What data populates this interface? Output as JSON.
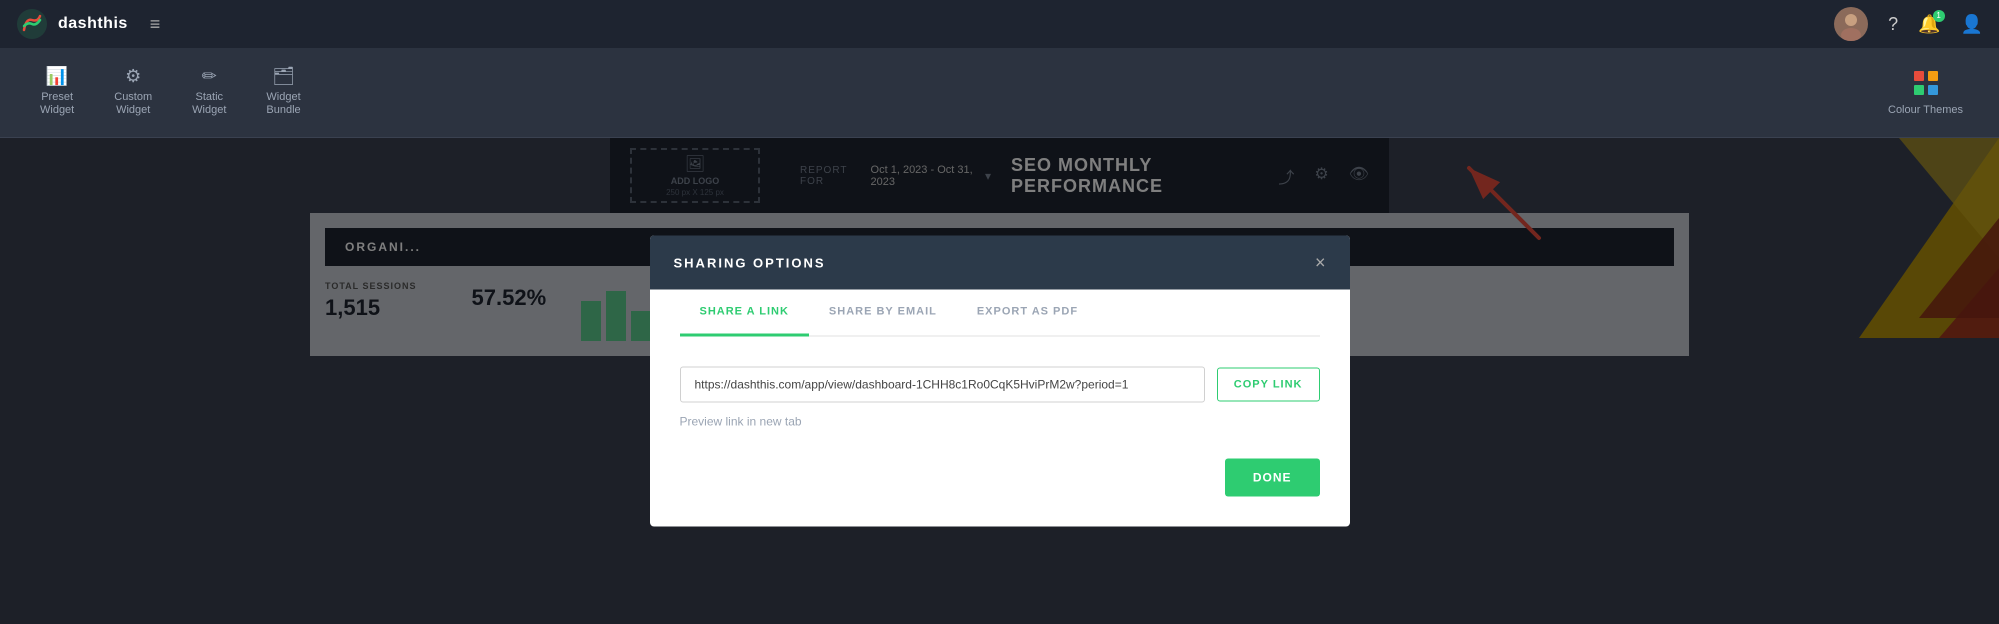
{
  "app": {
    "name": "dashthis",
    "hamburger": "≡"
  },
  "topnav": {
    "help_icon": "?",
    "notifications_icon": "🔔",
    "user_icon": "👤"
  },
  "toolbar": {
    "tabs": [
      {
        "id": "preset-widget",
        "icon": "📊",
        "label": "Preset\nWidget"
      },
      {
        "id": "custom-widget",
        "icon": "⚙",
        "label": "Custom\nWidget"
      },
      {
        "id": "static-widget",
        "icon": "✏",
        "label": "Static\nWidget"
      },
      {
        "id": "widget-bundle",
        "icon": "🗂",
        "label": "Widget\nBundle"
      }
    ],
    "colour_themes_label": "Colour Themes"
  },
  "dashboard": {
    "add_logo_line1": "ADD LOGO",
    "add_logo_line2": "250 px X 125 px",
    "report_for_label": "REPORT FOR",
    "report_date": "Oct 1, 2023 - Oct 31, 2023",
    "title": "SEO MONTHLY PERFORMANCE",
    "org_label": "ORGANI...",
    "total_sessions_label": "TOTAL SESSIONS",
    "total_sessions_value": "1,515",
    "metric2_value": "57.52%"
  },
  "sharing_modal": {
    "header": "SHARING OPTIONS",
    "close_label": "×",
    "tabs": [
      {
        "id": "share-link",
        "label": "SHARE A LINK",
        "active": true
      },
      {
        "id": "share-email",
        "label": "SHARE BY EMAIL",
        "active": false
      },
      {
        "id": "export-pdf",
        "label": "EXPORT AS PDF",
        "active": false
      }
    ],
    "link_value": "https://dashthis.com/app/view/dashboard-1CHH8c1Ro0CqK5HviPrM2w?period=1",
    "copy_link_label": "COPY LINK",
    "preview_link_label": "Preview link in new tab",
    "done_label": "DONE"
  }
}
